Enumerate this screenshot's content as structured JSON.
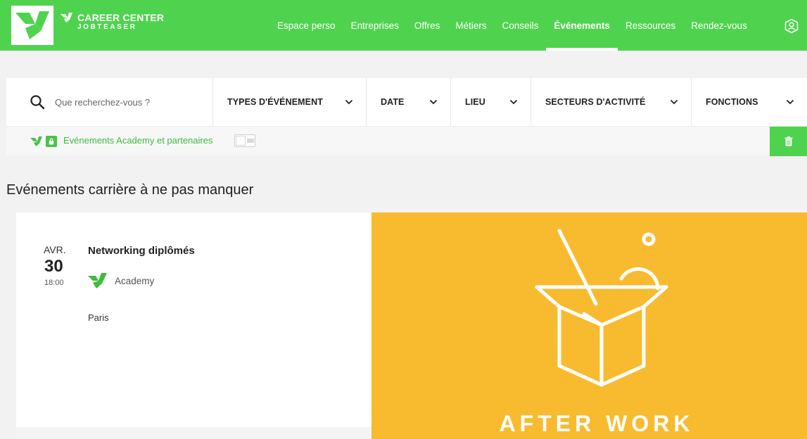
{
  "brand": {
    "title": "CAREER CENTER",
    "subtitle": "JOBTEASER",
    "color": "#4fd34f"
  },
  "nav": {
    "items": [
      {
        "label": "Espace perso"
      },
      {
        "label": "Entreprises"
      },
      {
        "label": "Offres"
      },
      {
        "label": "Métiers"
      },
      {
        "label": "Conseils"
      },
      {
        "label": "Événements",
        "active": true
      },
      {
        "label": "Ressources"
      },
      {
        "label": "Rendez-vous"
      }
    ],
    "profile_icon": "user-badge-icon"
  },
  "filters": {
    "search_placeholder": "Que recherchez-vous ?",
    "dropdowns": [
      {
        "label": "TYPES D'ÉVÉNEMENT"
      },
      {
        "label": "DATE"
      },
      {
        "label": "LIEU"
      },
      {
        "label": "SECTEURS D'ACTIVITÉ"
      },
      {
        "label": "FONCTIONS"
      }
    ],
    "toggle_label": "Evénements Academy et partenaires",
    "toggle_on": false
  },
  "section": {
    "title": "Evénements carrière à ne pas manquer"
  },
  "event": {
    "month": "AVR.",
    "day": "30",
    "time": "18:00",
    "title": "Networking diplômés",
    "organizer": "Academy",
    "location": "Paris",
    "image_caption": "AFTER WORK",
    "image_color": "#f8bb2f"
  }
}
